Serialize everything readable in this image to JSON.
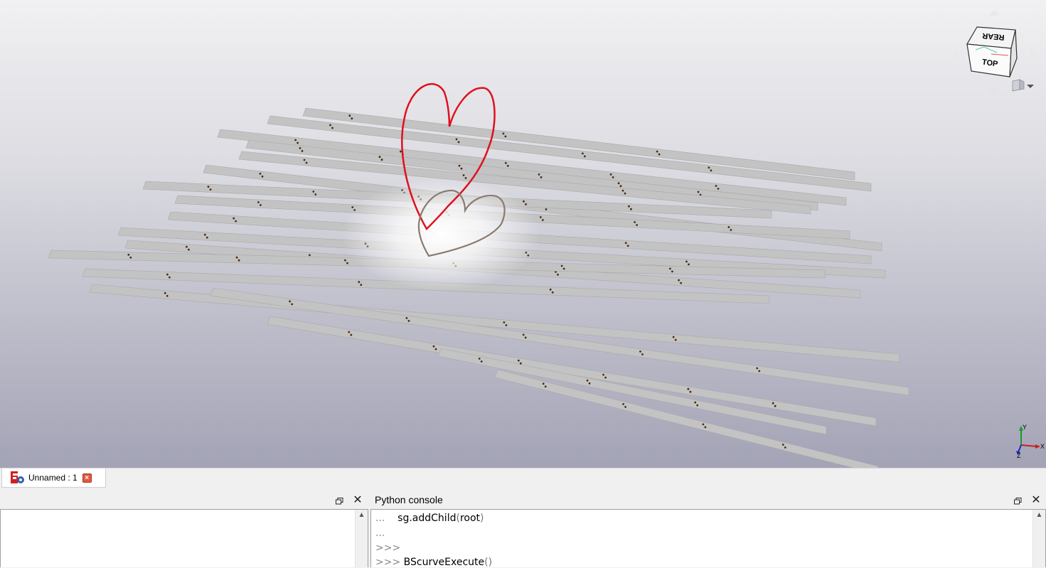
{
  "navcube": {
    "top_face": "REAR",
    "front_face": "TOP"
  },
  "axis": {
    "x": "X",
    "y": "Y",
    "z": "Z"
  },
  "document_tab": {
    "label": "Unnamed : 1",
    "icon": "freecad-document-icon",
    "close_icon": "close-icon"
  },
  "left_panel": {
    "title": "",
    "float_icon": "float-icon",
    "close_icon": "close-icon"
  },
  "python_console": {
    "title": "Python console",
    "float_icon": "float-icon",
    "close_icon": "close-icon",
    "lines": [
      {
        "prompt": "...",
        "code": "sg.addChild",
        "paren_open": "(",
        "arg": "root",
        "paren_close": ")"
      },
      {
        "prompt": "...",
        "code": "",
        "paren_open": "",
        "arg": "",
        "paren_close": ""
      },
      {
        "prompt": ">>>",
        "code": "",
        "paren_open": "",
        "arg": "",
        "paren_close": ""
      },
      {
        "prompt": ">>>",
        "code": "BScurveExecute",
        "paren_open": "(",
        "arg": "",
        "paren_close": ")"
      }
    ]
  },
  "colors": {
    "curve_red": "#e0101e",
    "curve_brown": "#8a7a6e",
    "strip_fill": "#c3c3c3",
    "hole_color": "#4a2a10"
  }
}
